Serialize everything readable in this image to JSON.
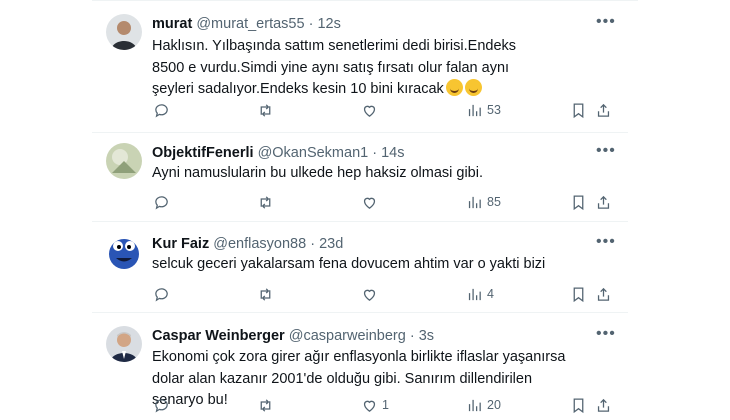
{
  "tweets": [
    {
      "name": "murat",
      "handle": "@murat_ertas55",
      "sep": "·",
      "time": "12s",
      "text": "Haklısın. Yılbaşında sattım senetlerimi dedi birisi.Endeks 8500 e vurdu.Simdi yine aynı satış fırsatı olur falan aynı şeyleri sadalıyor.Endeks kesin 10 bini kıracak",
      "emoji": [
        "rolling-on-floor-laughing",
        "rolling-on-floor-laughing"
      ],
      "likes": "",
      "views": "53"
    },
    {
      "name": "ObjektifFenerli",
      "handle": "@OkanSekman1",
      "sep": "·",
      "time": "14s",
      "text": "Ayni namuslularin bu ulkede hep haksiz olmasi gibi.",
      "likes": "",
      "views": "85"
    },
    {
      "name": "Kur Faiz",
      "handle": "@enflasyon88",
      "sep": "·",
      "time": "23d",
      "text": "selcuk geceri yakalarsam fena dovucem ahtim var o yakti bizi",
      "likes": "",
      "views": "4"
    },
    {
      "name": "Caspar Weinberger",
      "handle": "@casparweinberg",
      "sep": "·",
      "time": "3s",
      "text": "Ekonomi çok zora girer ağır enflasyonla birlikte iflaslar yaşanırsa dolar alan kazanır 2001'de olduğu gibi. Sanırım dillendirilen senaryo bu!",
      "likes": "1",
      "views": "20"
    }
  ],
  "icons": {
    "more": "more-icon",
    "reply": "reply-icon",
    "retweet": "retweet-icon",
    "like": "like-icon",
    "views": "views-icon",
    "bookmark": "bookmark-icon",
    "share": "share-icon"
  },
  "colors": {
    "secondary_text": "#536471",
    "divider": "#eff3f4",
    "primary_text": "#0f1419"
  }
}
